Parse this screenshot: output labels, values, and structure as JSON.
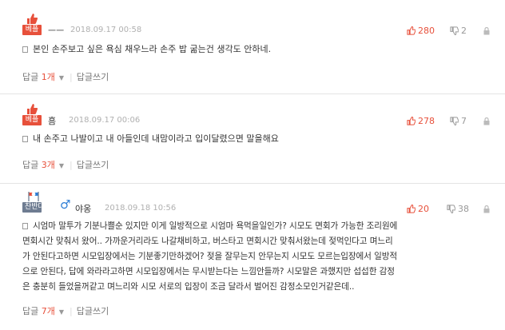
{
  "comments": [
    {
      "badge": "베플",
      "nickname": "ㅡㅡ",
      "date": "2018.09.17 00:58",
      "up": "280",
      "down": "2",
      "text": "본인 손주보고 싶은 욕심 채우느라 손주 밥 굶는건 생각도 안하네.",
      "reply_label": "답글",
      "reply_count": "1개",
      "write_label": "답글쓰기"
    },
    {
      "badge": "베플",
      "nickname": "흠",
      "date": "2018.09.17 00:06",
      "up": "278",
      "down": "7",
      "text": "내 손주고 나발이고 내 아들인데 내맘이라고 입이달렸으면 말을해요",
      "reply_label": "답글",
      "reply_count": "3개",
      "write_label": "답글쓰기"
    },
    {
      "badge": "찬반대결",
      "nickname": "야옹",
      "date": "2018.09.18 10:56",
      "up": "20",
      "down": "38",
      "lines": [
        "시엄마 말투가 기분나쁠순 있지만 이게 일방적으로 시엄마 욕먹을일인가? 시모도 면회가 가능한 조리원에",
        "면회시간 맞춰서 왔어.. 가까운거리라도 나갈채비하고, 버스타고 면회시간 맞춰서왔는데 젖먹인다고 며느리",
        "가 안된다고하면 시모입장에서는 기분좋기만하겠어? 젖을 잘무는지 안무는지 시모도 모르는입장에서 일방적",
        "으로 안된다, 답에 와라라고하면 시모입장에서는 무시받는다는 느낌안들까? 시모말은 과했지만 섭섭한 감정",
        "은 충분히 들었을꺼같고 며느리와 시모 서로의 입장이 조금 달라서 벌어진 감정소모인거같은데.."
      ],
      "reply_label": "답글",
      "reply_count": "7개",
      "write_label": "답글쓰기"
    }
  ],
  "colors": {
    "best": "#e7503b",
    "opp": "#6e7c91",
    "male": "#2e7ed6"
  }
}
